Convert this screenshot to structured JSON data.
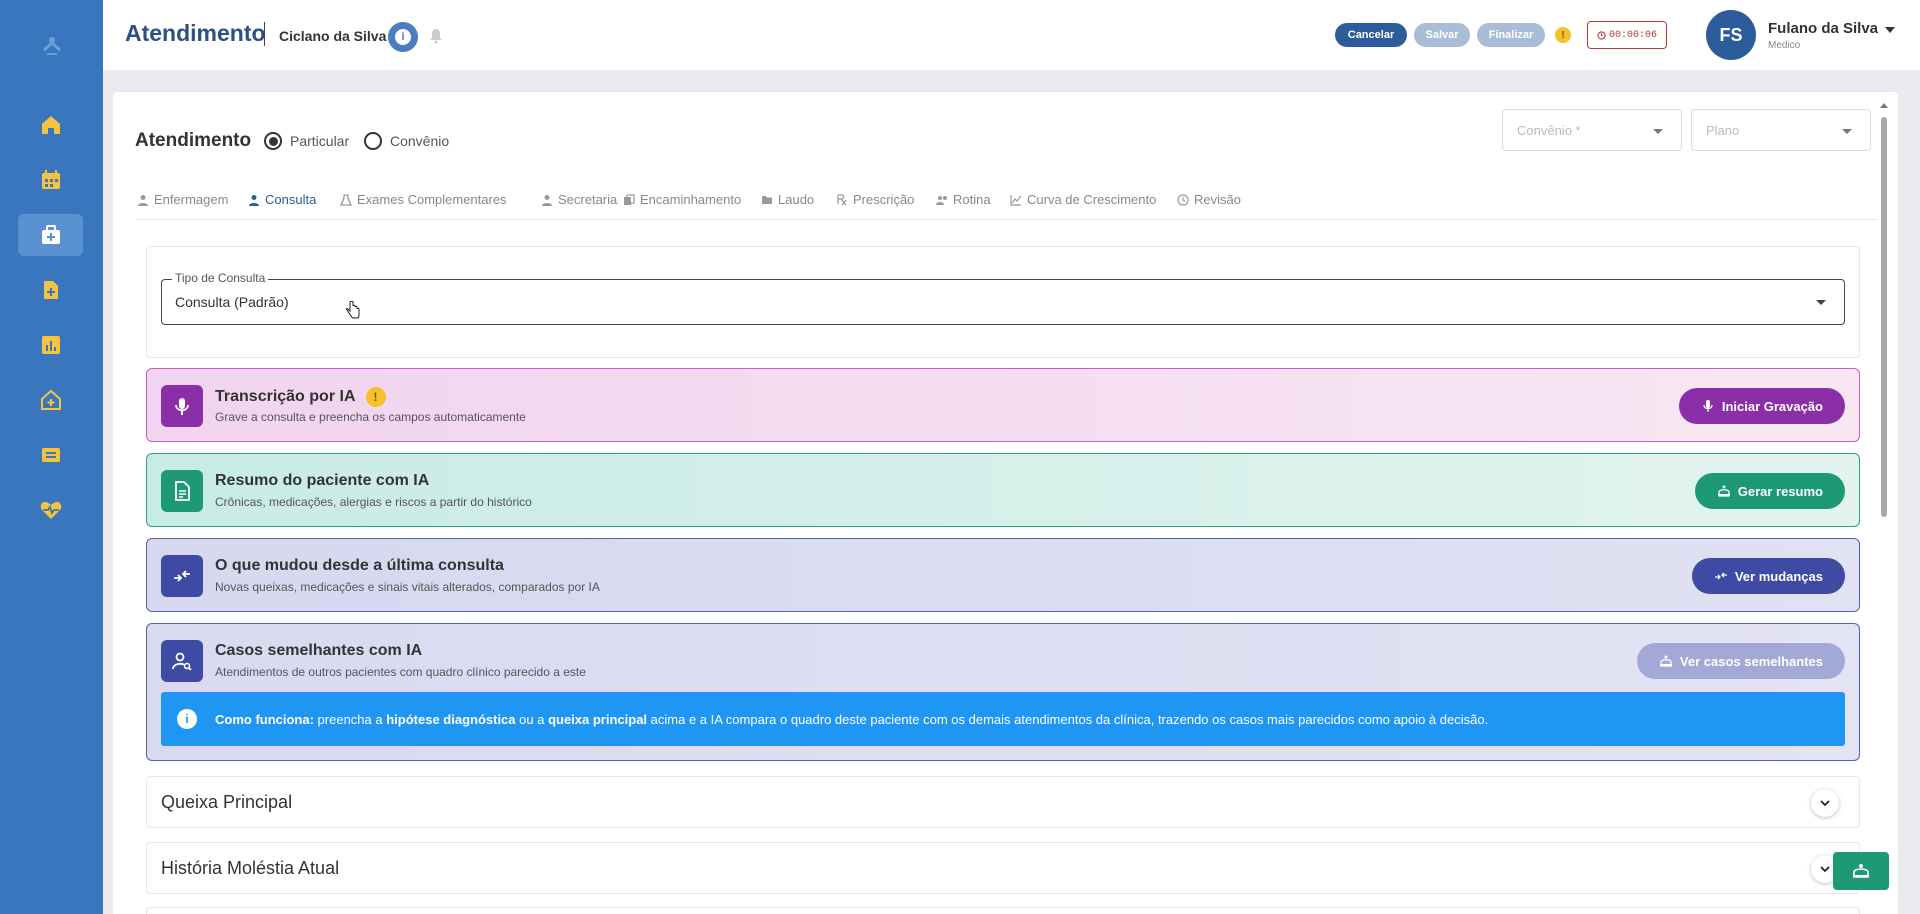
{
  "header": {
    "title": "Atendimento",
    "patient_name": "Ciclano da Silva",
    "info_glyph": "i",
    "cancel_label": "Cancelar",
    "save_label": "Salvar",
    "finish_label": "Finalizar",
    "warn_glyph": "!",
    "timer": "00:00:06",
    "user": {
      "initials": "FS",
      "name": "Fulano da Silva",
      "role": "Medico"
    }
  },
  "sidebar": {
    "items": [
      {
        "icon": "home-icon"
      },
      {
        "icon": "calendar-icon"
      },
      {
        "icon": "medical-case-icon",
        "active": true
      },
      {
        "icon": "document-plus-icon"
      },
      {
        "icon": "bar-chart-icon"
      },
      {
        "icon": "clinic-house-icon"
      },
      {
        "icon": "ticket-icon"
      },
      {
        "icon": "heart-pulse-icon"
      }
    ]
  },
  "main": {
    "title": "Atendimento",
    "payment_options": [
      "Particular",
      "Convênio"
    ],
    "payment_selected": "Particular",
    "convenio_placeholder": "Convênio *",
    "plano_placeholder": "Plano",
    "tabs": [
      {
        "label": "Enfermagem"
      },
      {
        "label": "Consulta",
        "active": true
      },
      {
        "label": "Exames Complementares"
      },
      {
        "label": "Secretaria"
      },
      {
        "label": "Encaminhamento"
      },
      {
        "label": "Laudo"
      },
      {
        "label": "Prescrição"
      },
      {
        "label": "Rotina"
      },
      {
        "label": "Curva de Crescimento"
      },
      {
        "label": "Revisão"
      }
    ],
    "consulta_type": {
      "label": "Tipo de Consulta",
      "value": "Consulta (Padrão)"
    }
  },
  "ai_cards": [
    {
      "title": "Transcrição por IA",
      "subtitle": "Grave a consulta e preencha os campos automaticamente",
      "button": "Iniciar Gravação",
      "icon": "microphone-icon",
      "color": "#8a2fa7"
    },
    {
      "title": "Resumo do paciente com IA",
      "subtitle": "Crônicas, medicações, alergias e riscos a partir do histórico",
      "button": "Gerar resumo",
      "icon": "document-icon",
      "color": "#1e9975"
    },
    {
      "title": "O que mudou desde a última consulta",
      "subtitle": "Novas queixas, medicações e sinais vitais alterados, comparados por IA",
      "button": "Ver mudanças",
      "icon": "compare-arrows-icon",
      "color": "#3e4aa3"
    },
    {
      "title": "Casos semelhantes com IA",
      "subtitle": "Atendimentos de outros pacientes com quadro clínico parecido a este",
      "button": "Ver casos semelhantes",
      "icon": "person-search-icon",
      "color": "#3e4aa3",
      "button_color": "#a3a9d6"
    }
  ],
  "info": {
    "glyph": "i",
    "parts": [
      {
        "text": "Como funciona:",
        "bold": true
      },
      {
        "text": " preencha a "
      },
      {
        "text": "hipótese diagnóstica",
        "bold": true
      },
      {
        "text": " ou a "
      },
      {
        "text": "queixa principal",
        "bold": true
      },
      {
        "text": " acima e a IA compara o quadro deste paciente com os demais atendimentos da clínica, trazendo os casos mais parecidos como apoio à decisão."
      }
    ]
  },
  "sections": [
    "Queixa Principal",
    "História Moléstia Atual"
  ],
  "colors": {
    "sidebar": "#3a76bd",
    "primary": "#2d5c9c",
    "info": "#1f97f2",
    "sidebar_icon": "#f6c340"
  }
}
